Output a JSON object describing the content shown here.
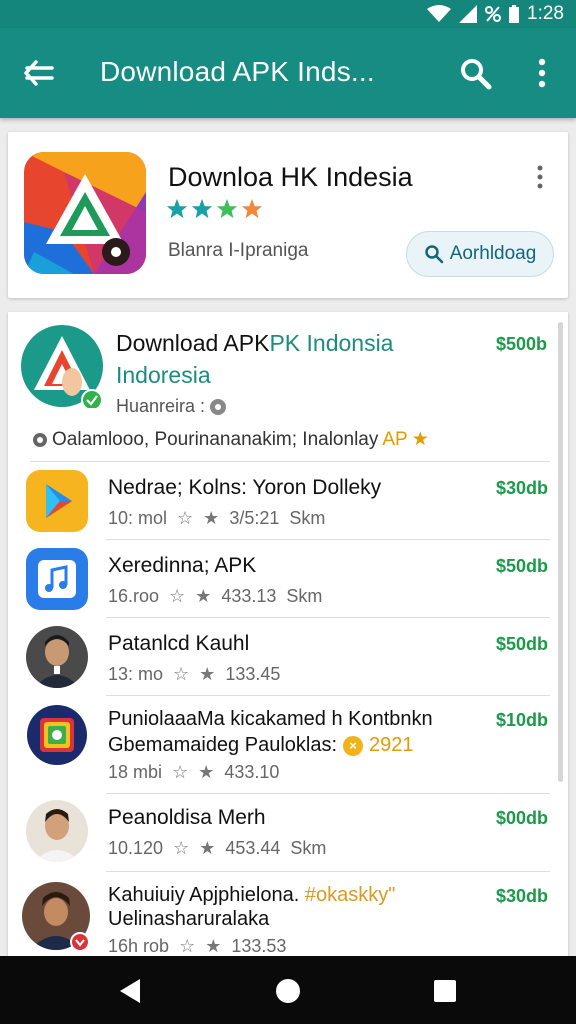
{
  "status_bar": {
    "time": "1:28",
    "icons": [
      "wifi-icon",
      "signal-icon",
      "data-saver-icon",
      "battery-icon"
    ]
  },
  "app_bar": {
    "title": "Download APK Inds...",
    "icons": [
      "back-arrow-icon",
      "search-icon",
      "more-vert-icon"
    ],
    "color": "#168c82"
  },
  "header": {
    "app_name": "Downloa HK Indesia",
    "developer": "Blanra I-Ipraniga",
    "rating_stars": 4,
    "download_label": "Aorhldoag"
  },
  "list": {
    "featured": {
      "name_part1": "Download APK",
      "name_part2": "PK Indonsia",
      "name_line2": "Indoresia",
      "sub": "Huanreira :",
      "tags": "Oalamlooo, Pourinananakim; Inalonlay",
      "tag_highlight": "AP",
      "price": "$500b"
    },
    "items": [
      {
        "name": "Nedrae; Kolns: Yoron Dolleky",
        "meta_left": "10: mol",
        "meta_right": "3/5:21",
        "meta_extra": "Skm",
        "price": "$30db",
        "icon": "play-store-icon"
      },
      {
        "name": "Xeredinna; APK",
        "meta_left": "16.roo",
        "meta_right": "433.13",
        "meta_extra": "Skm",
        "price": "$50db",
        "icon": "music-note-icon"
      },
      {
        "name": "Patanlcd Kauhl",
        "meta_left": "13: mo",
        "meta_right": "133.45",
        "meta_extra": "",
        "price": "$50db",
        "icon": "person-avatar"
      },
      {
        "name": "PuniolaaaMa kicakamed h Kontbnkn",
        "line2": "Gbemamaideg Pauloklas:",
        "line2_year": "2921",
        "meta_left": "18 mbi",
        "meta_right": "433.10",
        "meta_extra": "",
        "price": "$10db",
        "icon": "photo-app-icon"
      },
      {
        "name": "Peanoldisa Merh",
        "meta_left": "10.120",
        "meta_right": "453.44",
        "meta_extra": "Skm",
        "price": "$00db",
        "icon": "person-avatar"
      },
      {
        "name": "Kahuiuiy Apjphielona.",
        "name_hl": "#okaskky\"",
        "line2": "Uelinasharuralaka",
        "meta_left": "16h rob",
        "meta_right": "133.53",
        "meta_extra": "",
        "price": "$30db",
        "icon": "person-avatar"
      }
    ]
  },
  "colors": {
    "teal": "#168c82",
    "price_green": "#1a9a4a",
    "star_teal": "#1aa0a8",
    "star_green": "#3fbf5a",
    "star_orange": "#f08a3a"
  }
}
